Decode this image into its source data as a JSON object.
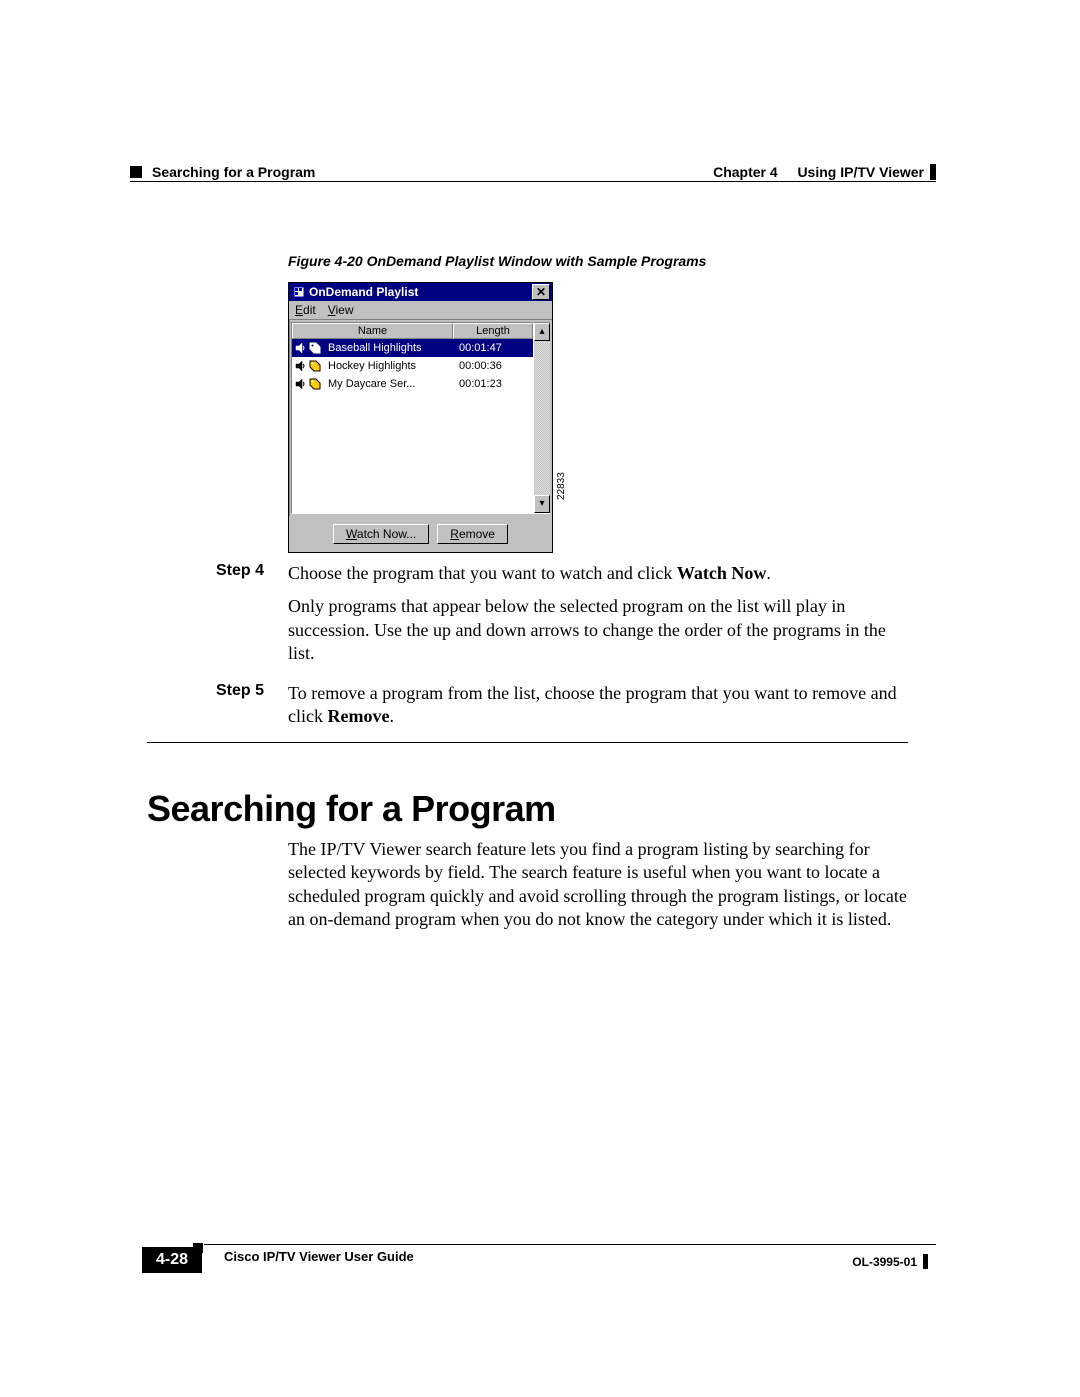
{
  "header": {
    "chapter_label": "Chapter 4",
    "chapter_title": "Using IP/TV Viewer",
    "section_breadcrumb": "Searching for a Program"
  },
  "figure": {
    "caption": "Figure 4-20   OnDemand Playlist Window with Sample Programs",
    "ref_number": "22833"
  },
  "window": {
    "title": "OnDemand Playlist",
    "menu": {
      "edit": "Edit",
      "view": "View"
    },
    "columns": {
      "name": "Name",
      "length": "Length"
    },
    "rows": [
      {
        "name": "Baseball Highlights",
        "length": "00:01:47",
        "selected": true
      },
      {
        "name": "Hockey Highlights",
        "length": "00:00:36",
        "selected": false
      },
      {
        "name": "My Daycare Ser...",
        "length": "00:01:23",
        "selected": false
      }
    ],
    "buttons": {
      "watch_now": "Watch Now...",
      "remove": "Remove"
    }
  },
  "steps": {
    "s4": {
      "label": "Step 4",
      "p1_a": "Choose the program that you want to watch and click ",
      "p1_b": "Watch Now",
      "p1_c": ".",
      "p2": "Only programs that appear below the selected program on the list will play in succession. Use the up and down arrows to change the order of the programs in the list."
    },
    "s5": {
      "label": "Step 5",
      "p1_a": "To remove a program from the list, choose the program that you want to remove and click ",
      "p1_b": "Remove",
      "p1_c": "."
    }
  },
  "section": {
    "title": "Searching for a Program",
    "body": "The IP/TV Viewer search feature lets you find a program listing by searching for selected keywords by field. The search feature is useful when you want to locate a scheduled program quickly and avoid scrolling through the program listings, or locate an on-demand program when you do not know the category under which it is listed."
  },
  "footer": {
    "guide_title": "Cisco IP/TV Viewer User Guide",
    "page_number": "4-28",
    "doc_id": "OL-3995-01"
  }
}
